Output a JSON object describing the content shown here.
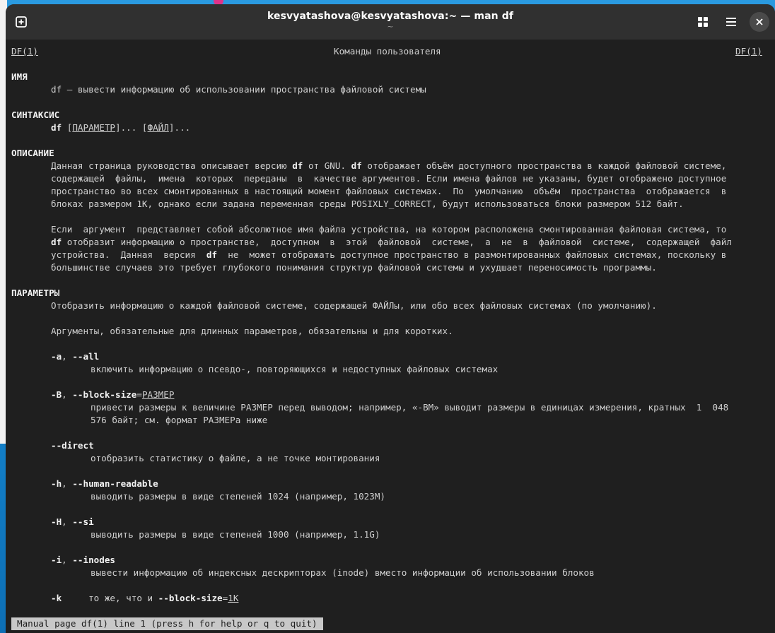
{
  "window": {
    "title": "kesvyatashova@kesvyatashova:~ — man df",
    "subtitle": "~"
  },
  "icons": {
    "new_tab": "new-tab-icon",
    "view": "grid-icon",
    "menu": "hamburger-menu-icon",
    "close": "close-icon"
  },
  "man": {
    "header": {
      "left": "DF(1)",
      "center": "Команды пользователя",
      "right": "DF(1)"
    },
    "name_heading": "ИМЯ",
    "name_text": "df — вывести информацию об использовании пространства файловой системы",
    "synopsis_heading": "СИНТАКСИС",
    "synopsis": {
      "cmd": "df",
      "p1": " [",
      "param": "ПАРАМЕТР",
      "p2": "]... [",
      "file": "ФАЙЛ",
      "p3": "]..."
    },
    "description_heading": "ОПИСАНИЕ",
    "desc1": {
      "l1a": "Данная страница руководства описывает версию ",
      "l1b": "df",
      "l1c": " от GNU. ",
      "l1d": "df",
      "l1e": " отображает объём доступного пространства в каждой файловой системе,",
      "l2": "содержащей  файлы,  имена  которых  переданы  в  качестве аргументов. Если имена файлов не указаны, будет отображено доступное",
      "l3": "пространство во всех смонтированных в настоящий момент файловых системах.  По  умолчанию  объём  пространства  отображается  в",
      "l4": "блоках размером 1K, однако если задана переменная среды POSIXLY_CORRECT, будут использоваться блоки размером 512 байт."
    },
    "desc2": {
      "l1": "Если  аргумент  представляет собой абсолютное имя файла устройства, на котором расположена смонтированная файловая система, то",
      "l2a": "df",
      "l2b": " отобразит информацию о пространстве,  доступном  в  этой  файловой  системе,  а  не  в  файловой  системе,  содержащей  файл",
      "l3a": "устройства.  Данная  версия  ",
      "l3b": "df",
      "l3c": "  не  может отображать доступное пространство в размонтированных файловых системах, поскольку в",
      "l4": "большинстве случаев это требует глубокого понимания структур файловой системы и ухудшает переносимость программы."
    },
    "options_heading": "ПАРАМЕТРЫ",
    "options_intro": "Отобразить информацию о каждой файловой системе, содержащей ФАЙЛы, или обо всех файловых системах (по умолчанию).",
    "options_args": "Аргументы, обязательные для длинных параметров, обязательны и для коротких.",
    "opt_a": {
      "flag1": "-a",
      "sep": ", ",
      "flag2": "--all",
      "desc": "включить информацию о псевдо-, повторяющихся и недоступных файловых системах"
    },
    "opt_B": {
      "flag1": "-B",
      "sep": ", ",
      "flag2": "--block-size",
      "eq": "=",
      "arg": "РАЗМЕР",
      "desc1": "привести размеры к величине РАЗМЕР перед выводом; например, «-BM» выводит размеры в единицах измерения, кратных  1  048",
      "desc2": "576 байт; см. формат РАЗМЕРа ниже"
    },
    "opt_direct": {
      "flag": "--direct",
      "desc": "отобразить статистику о файле, а не точке монтирования"
    },
    "opt_h": {
      "flag1": "-h",
      "sep": ", ",
      "flag2": "--human-readable",
      "desc": "выводить размеры в виде степеней 1024 (например, 1023M)"
    },
    "opt_H": {
      "flag1": "-H",
      "sep": ", ",
      "flag2": "--si",
      "desc": "выводить размеры в виде степеней 1000 (например, 1.1G)"
    },
    "opt_i": {
      "flag1": "-i",
      "sep": ", ",
      "flag2": "--inodes",
      "desc": "вывести информацию об индексных дескрипторах (inode) вместо информации об использовании блоков"
    },
    "opt_k": {
      "flag": "-k",
      "mid": "     то же, что и ",
      "flag2": "--block-size",
      "eq": "=",
      "arg": "1K"
    }
  },
  "status": "Manual page df(1) line 1 (press h for help or q to quit)"
}
